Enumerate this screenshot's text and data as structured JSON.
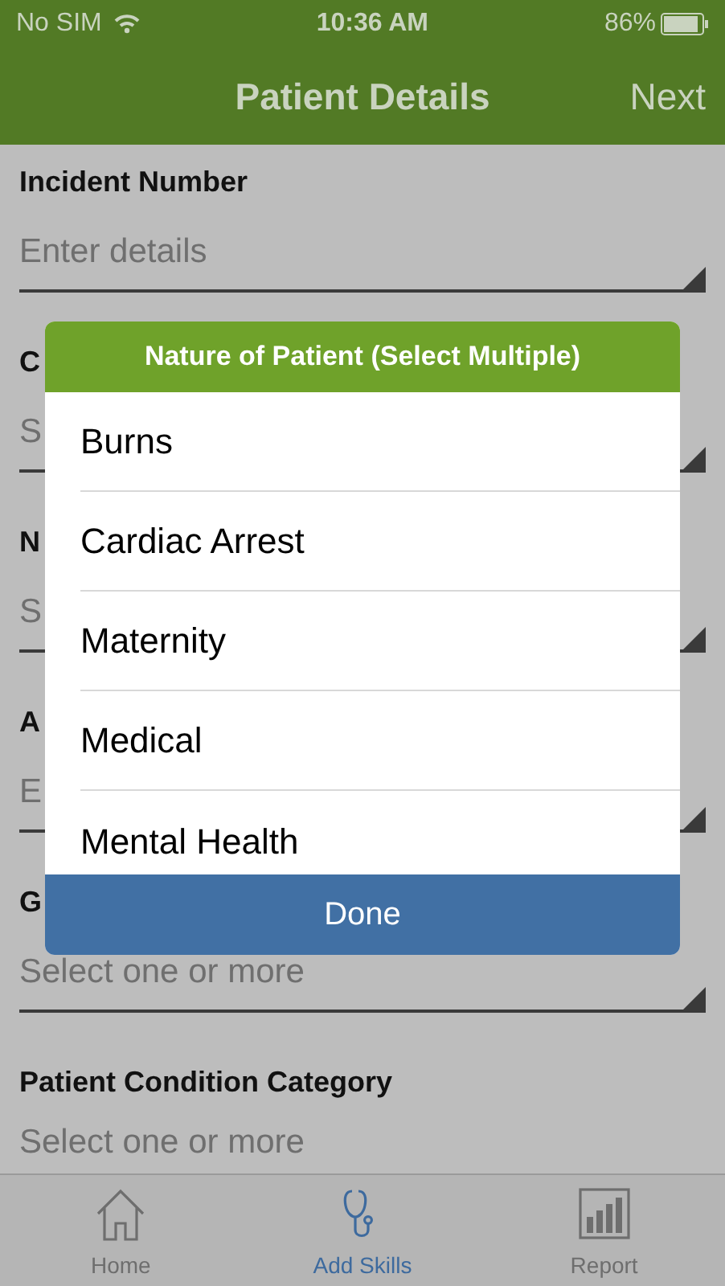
{
  "status_bar": {
    "carrier": "No SIM",
    "time": "10:36 AM",
    "battery": "86%"
  },
  "nav_bar": {
    "title": "Patient Details",
    "action": "Next"
  },
  "fields": [
    {
      "label": "Incident Number",
      "placeholder": "Enter details"
    },
    {
      "label": "C",
      "placeholder": "S"
    },
    {
      "label": "N",
      "placeholder": "S"
    },
    {
      "label": "A",
      "placeholder": "E"
    },
    {
      "label": "G",
      "placeholder": "Select one or more"
    },
    {
      "label": "Patient Condition Category",
      "placeholder": "Select one or more"
    }
  ],
  "dialog": {
    "title": "Nature of Patient (Select Multiple)",
    "options": [
      "Burns",
      "Cardiac Arrest",
      "Maternity",
      "Medical",
      "Mental Health"
    ],
    "done": "Done"
  },
  "tab_bar": [
    {
      "label": "Home",
      "selected": false
    },
    {
      "label": "Add Skills",
      "selected": true
    },
    {
      "label": "Report",
      "selected": false
    }
  ]
}
